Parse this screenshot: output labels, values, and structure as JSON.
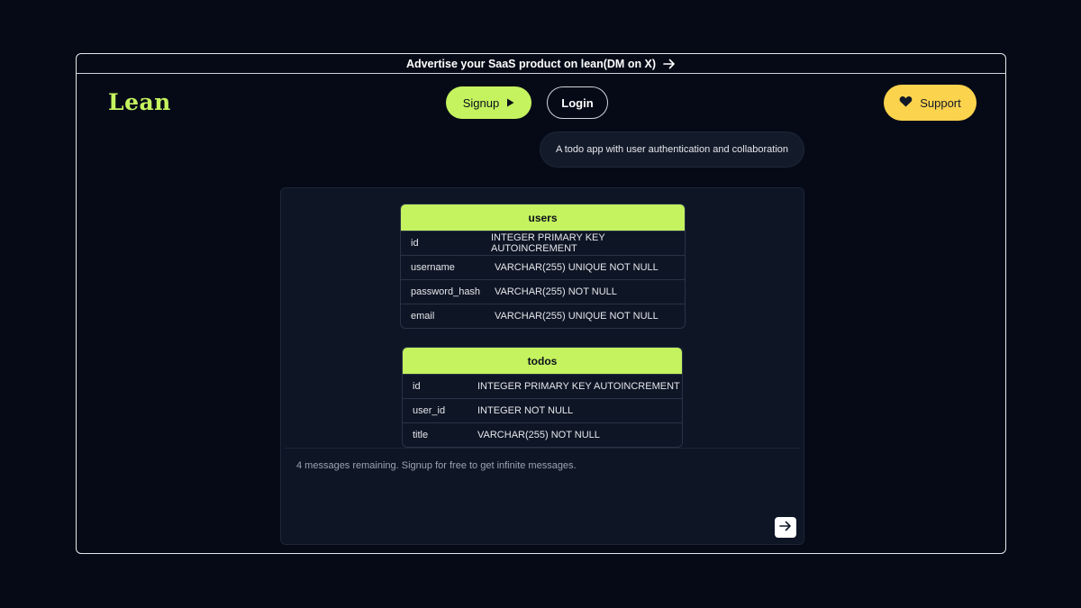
{
  "banner": {
    "text": "Advertise your SaaS product on lean(DM on X)",
    "icon": "arrow-right-icon"
  },
  "header": {
    "logo": "Lean",
    "signup_label": "Signup",
    "login_label": "Login",
    "support_label": "Support"
  },
  "chat": {
    "user_prompt": "A todo app with user authentication and collaboration",
    "notice": "4 messages remaining. Signup for free to get infinite messages."
  },
  "schema": {
    "users": {
      "title": "users",
      "rows": [
        {
          "name": "id",
          "type": "INTEGER PRIMARY KEY AUTOINCREMENT"
        },
        {
          "name": "username",
          "type": "VARCHAR(255) UNIQUE NOT NULL"
        },
        {
          "name": "password_hash",
          "type": "VARCHAR(255) NOT NULL"
        },
        {
          "name": "email",
          "type": "VARCHAR(255) UNIQUE NOT NULL"
        }
      ]
    },
    "todos": {
      "title": "todos",
      "rows": [
        {
          "name": "id",
          "type": "INTEGER PRIMARY KEY AUTOINCREMENT"
        },
        {
          "name": "user_id",
          "type": "INTEGER NOT NULL"
        },
        {
          "name": "title",
          "type": "VARCHAR(255) NOT NULL"
        }
      ]
    }
  },
  "colors": {
    "accent": "#c4f35f",
    "support": "#fcd34d",
    "background": "#060a17",
    "panel": "#0e1525"
  }
}
